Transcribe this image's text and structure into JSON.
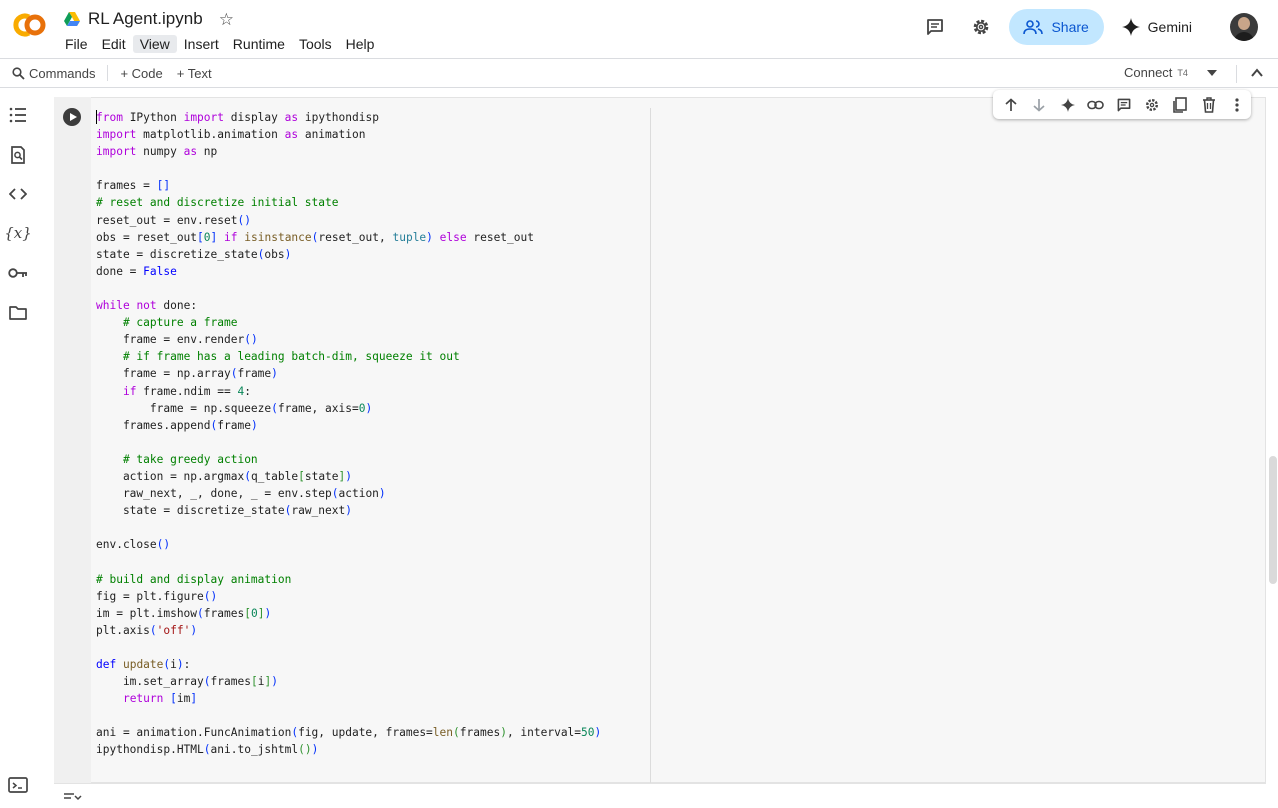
{
  "header": {
    "logo": "colab-logo",
    "drive_icon": "google-drive-icon",
    "title": "RL Agent.ipynb",
    "star_icon": "star-icon",
    "menu": [
      {
        "label": "File"
      },
      {
        "label": "Edit"
      },
      {
        "label": "View"
      },
      {
        "label": "Insert"
      },
      {
        "label": "Runtime"
      },
      {
        "label": "Tools"
      },
      {
        "label": "Help"
      }
    ],
    "active_menu": "View",
    "share_label": "Share",
    "gemini_label": "Gemini",
    "accent_color": "#c2e7ff",
    "share_text_color": "#0b57d0"
  },
  "toolbar": {
    "commands_label": "Commands",
    "code_label": "+ Code",
    "text_label": "+ Text",
    "connect_label": "Connect",
    "runtime_type": "T4"
  },
  "rail": [
    {
      "name": "table-of-contents-icon"
    },
    {
      "name": "find-replace-icon"
    },
    {
      "name": "code-snippets-icon"
    },
    {
      "name": "variables-icon"
    },
    {
      "name": "secrets-key-icon"
    },
    {
      "name": "files-folder-icon"
    }
  ],
  "cell_toolbar": [
    "move-up-icon",
    "move-down-icon",
    "gemini-sparkle-icon",
    "link-icon",
    "comment-icon",
    "settings-icon",
    "mirror-cell-icon",
    "delete-icon",
    "more-options-icon"
  ],
  "code_lines": [
    "from IPython import display as ipythondisp",
    "import matplotlib.animation as animation",
    "import numpy as np",
    "",
    "frames = []",
    "# reset and discretize initial state",
    "reset_out = env.reset()",
    "obs = reset_out[0] if isinstance(reset_out, tuple) else reset_out",
    "state = discretize_state(obs)",
    "done = False",
    "",
    "while not done:",
    "    # capture a frame",
    "    frame = env.render()",
    "    # if frame has a leading batch-dim, squeeze it out",
    "    frame = np.array(frame)",
    "    if frame.ndim == 4:",
    "        frame = np.squeeze(frame, axis=0)",
    "    frames.append(frame)",
    "",
    "    # take greedy action",
    "    action = np.argmax(q_table[state])",
    "    raw_next, _, done, _ = env.step(action)",
    "    state = discretize_state(raw_next)",
    "",
    "env.close()",
    "",
    "# build and display animation",
    "fig = plt.figure()",
    "im = plt.imshow(frames[0])",
    "plt.axis('off')",
    "",
    "def update(i):",
    "    im.set_array(frames[i])",
    "    return [im]",
    "",
    "ani = animation.FuncAnimation(fig, update, frames=len(frames), interval=50)",
    "ipythondisp.HTML(ani.to_jshtml())"
  ]
}
